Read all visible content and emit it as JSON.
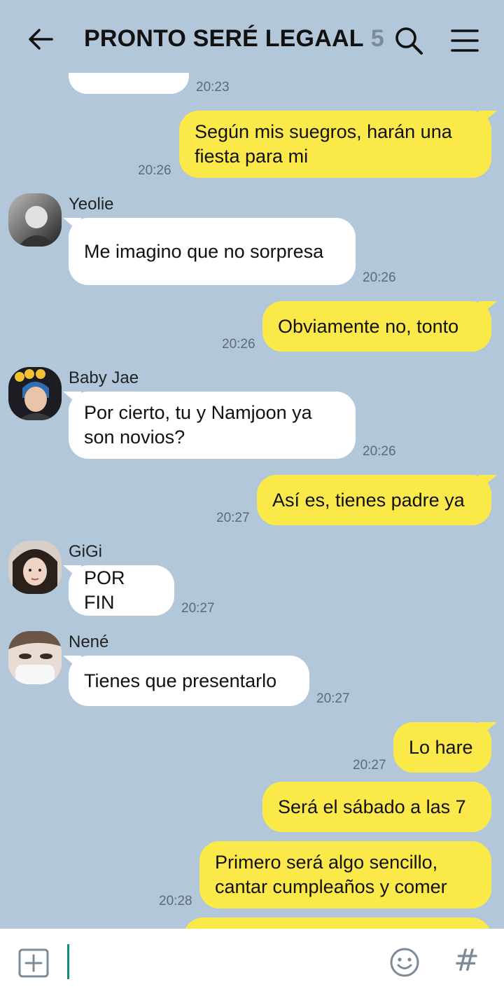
{
  "header": {
    "title": "PRONTO SERÉ LEGAAL",
    "member_count": "5",
    "icons": {
      "back": "arrow-left-icon",
      "search": "search-icon",
      "menu": "hamburger-menu-icon"
    }
  },
  "colors": {
    "background": "#b2c7da",
    "incoming": "#ffffff",
    "outgoing": "#fbe94a",
    "accent": "#0f8f7a"
  },
  "messages": [
    {
      "type": "in",
      "text": "",
      "time": "20:23"
    },
    {
      "type": "out",
      "text": "Según mis suegros, harán una fiesta para mi",
      "time": "20:26"
    },
    {
      "type": "in",
      "sender": "Yeolie",
      "text": "Me imagino que no sorpresa",
      "time": "20:26"
    },
    {
      "type": "out",
      "text": "Obviamente no, tonto",
      "time": "20:26"
    },
    {
      "type": "in",
      "sender": "Baby Jae",
      "text": "Por cierto, tu y Namjoon ya son novios?",
      "time": "20:26"
    },
    {
      "type": "out",
      "text": "Así es, tienes padre ya",
      "time": "20:27"
    },
    {
      "type": "in",
      "sender": "GiGi",
      "text": "POR FIN",
      "time": "20:27"
    },
    {
      "type": "in",
      "sender": "Nené",
      "text": "Tienes que presentarlo",
      "time": "20:27"
    },
    {
      "type": "out",
      "text": "Lo hare",
      "time": "20:27"
    },
    {
      "type": "out",
      "text": "Será el sábado a las 7",
      "time": ""
    },
    {
      "type": "out",
      "text": "Primero será algo sencillo, cantar cumpleaños y comer",
      "time": "20:28"
    },
    {
      "type": "out",
      "text": "",
      "time": ""
    }
  ],
  "composer": {
    "icons": {
      "add": "plus-square-icon",
      "emoji": "emoji-icon",
      "hashtag": "hashtag-icon"
    },
    "input_value": "",
    "hash_symbol": "#"
  }
}
